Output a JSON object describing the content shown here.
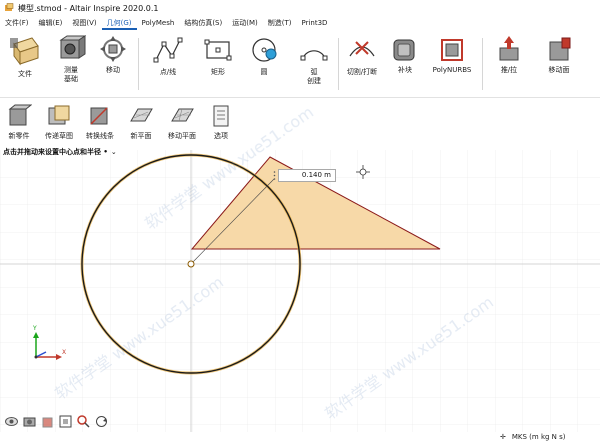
{
  "window": {
    "title": "模型.stmod - Altair Inspire 2020.0.1"
  },
  "menu": [
    {
      "label": "文件(F)"
    },
    {
      "label": "编辑(E)"
    },
    {
      "label": "视图(V)"
    },
    {
      "label": "几何(G)",
      "active": true
    },
    {
      "label": "PolyMesh"
    },
    {
      "label": "结构仿真(S)"
    },
    {
      "label": "运动(M)"
    },
    {
      "label": "制造(T)"
    },
    {
      "label": "Print3D"
    }
  ],
  "ribbon": {
    "file": "文件",
    "measure": "测量\n基础",
    "move": "移动",
    "point_line": "点/线",
    "rect": "矩形",
    "circle": "圆",
    "arc": "弧\n创建",
    "trim": "切割/打断",
    "patch": "补块",
    "polynurbs": "PolyNURBS",
    "push_pull": "推/拉",
    "move_face": "移动面"
  },
  "subbar": {
    "new_part": "新零件",
    "pass_sketch": "传递草图",
    "convert_lines": "转换线条",
    "new_plane": "新平面",
    "move_plane": "移动平面",
    "options": "选项"
  },
  "hint": "点击并拖动来设置中心点和半径 •",
  "dimension_input": "0.140 m",
  "status": {
    "units": "MKS (m kg N s)"
  },
  "watermark": "软件学堂 www.xue51.com",
  "colors": {
    "triangle_fill": "#f7d9a8",
    "triangle_stroke": "#8b1a1a",
    "circle_stroke": "#1a1a1a",
    "circle_glow": "#e8b24a",
    "grid": "#e3e3e3",
    "axis": "#c8c8c8",
    "accent": "#1a5fb4"
  }
}
